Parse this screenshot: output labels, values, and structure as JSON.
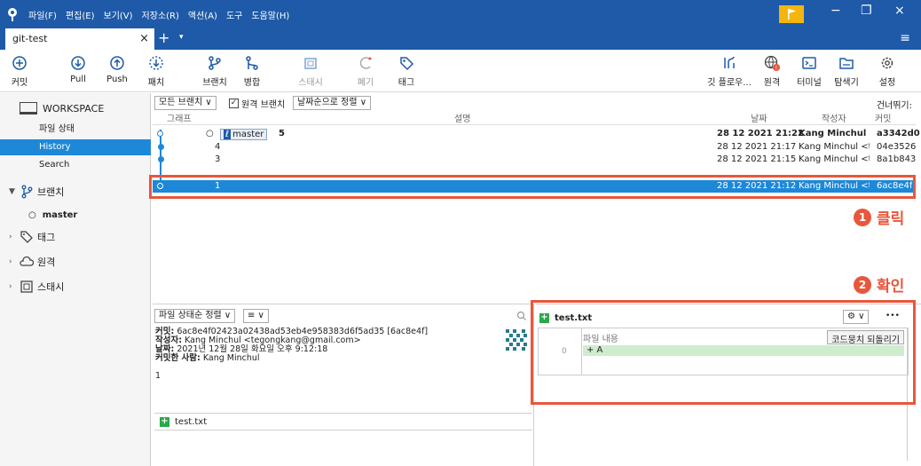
{
  "titlebar": {
    "menus": [
      "파일(F)",
      "편집(E)",
      "보기(V)",
      "저장소(R)",
      "액션(A)",
      "도구",
      "도움말(H)"
    ],
    "tab_title": "git-test",
    "tab_close": "×",
    "tab_plus": "+",
    "tab_dropdown": "▾",
    "hamburger": "≡",
    "min": "−",
    "restore": "❐",
    "close": "×",
    "accent": "#1e5aa8",
    "flag_color": "#f5b50f"
  },
  "toolbar": {
    "commit": "커밋",
    "pull": "Pull",
    "push": "Push",
    "fetch": "패치",
    "branch": "브랜치",
    "merge": "병합",
    "stash": "스태시",
    "discard": "폐기",
    "tag": "태그",
    "gitflow": "깃 플로우...",
    "remote": "원격",
    "terminal": "터미널",
    "explorer": "탐색기",
    "settings": "설정"
  },
  "sidebar": {
    "workspace": "WORKSPACE",
    "file_status": "파일 상태",
    "history": "History",
    "search": "Search",
    "branches": "브랜치",
    "branch_master": "master",
    "tags": "태그",
    "remotes": "원격",
    "stashes": "스태시"
  },
  "history": {
    "filter_branches": "모든 브랜치 ∨",
    "remote_branches": "원격 브랜치",
    "remote_checked": "✓",
    "sort": "날짜순으로 정렬 ∨",
    "skip": "건너뛰기:",
    "columns": {
      "graph": "그래프",
      "description": "설명",
      "date": "날짜",
      "author": "작성자",
      "commit": "커밋"
    },
    "rows": [
      {
        "description": "5",
        "branch_tag": "master",
        "date": "28 12 2021 21:22",
        "author": "Kang Minchul <t",
        "commit": "a3342d0"
      },
      {
        "description": "4",
        "date": "28 12 2021 21:17",
        "author": "Kang Minchul <te",
        "commit": "04e3526"
      },
      {
        "description": "3",
        "date": "28 12 2021 21:15",
        "author": "Kang Minchul <te",
        "commit": "8a1b843"
      },
      {
        "description": "1",
        "date": "28 12 2021 21:12",
        "author": "Kang Minchul <te",
        "commit": "6ac8e4f"
      }
    ]
  },
  "annotations": {
    "step1_num": "1",
    "step1_text": "클릭",
    "step2_num": "2",
    "step2_text": "확인",
    "color": "#e8573c"
  },
  "details": {
    "sort_status": "파일 상태순 정렬 ∨",
    "view_mode": "≡ ∨",
    "commit_label": "커밋:",
    "commit_value": "6ac8e4f02423a02438ad53eb4e958383d6f5ad35 [6ac8e4f]",
    "author_label": "작성자:",
    "author_value": "Kang Minchul <tegongkang@gmail.com>",
    "date_label": "날짜:",
    "date_value": "2021년 12월 28일 화요일 오후 9:12:18",
    "committer_label": "커밋한 사람:",
    "committer_value": "Kang Minchul",
    "message": "1",
    "file_name": "test.txt"
  },
  "diff": {
    "file_name": "test.txt",
    "settings_dd": "⚙ ∨",
    "more": "•••",
    "content_header": "파일 내용",
    "revert_button": "코드뭉치 되돌리기",
    "line_number": "0",
    "added_line": "+ A"
  }
}
